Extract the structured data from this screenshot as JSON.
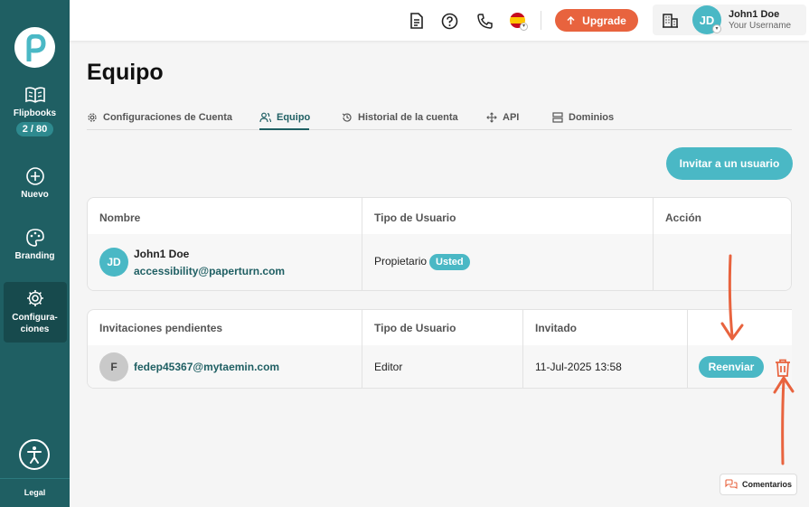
{
  "sidebar": {
    "items": [
      {
        "label": "Flipbooks",
        "icon": "book-icon",
        "badge": "2 / 80"
      },
      {
        "label": "Nuevo",
        "icon": "plus-circle-icon"
      },
      {
        "label": "Branding",
        "icon": "palette-icon"
      },
      {
        "label": "Configura-\nciones",
        "icon": "gear-icon",
        "active": true
      }
    ],
    "legal": "Legal"
  },
  "header": {
    "upgrade_label": "Upgrade",
    "user_initials": "JD",
    "user_name": "John1 Doe",
    "user_username": "Your Username"
  },
  "page": {
    "title": "Equipo",
    "tabs": [
      {
        "label": "Configuraciones de Cuenta",
        "icon": "gear-icon"
      },
      {
        "label": "Equipo",
        "icon": "users-icon",
        "active": true
      },
      {
        "label": "Historial de la cuenta",
        "icon": "history-icon"
      },
      {
        "label": "API",
        "icon": "move-icon"
      },
      {
        "label": "Dominios",
        "icon": "server-icon"
      }
    ],
    "invite_button": "Invitar a un usuario"
  },
  "members_table": {
    "headers": [
      "Nombre",
      "Tipo de Usuario",
      "Acción"
    ],
    "rows": [
      {
        "initials": "JD",
        "name": "John1 Doe",
        "email": "accessibility@paperturn.com",
        "type": "Propietario",
        "badge": "Usted"
      }
    ]
  },
  "invites_table": {
    "headers": [
      "Invitaciones pendientes",
      "Tipo de Usuario",
      "Invitado"
    ],
    "rows": [
      {
        "initials": "F",
        "email": "fedep45367@mytaemin.com",
        "type": "Editor",
        "invited": "11-Jul-2025 13:58",
        "action": "Reenviar"
      }
    ]
  },
  "comments_label": "Comentarios",
  "colors": {
    "sidebar": "#1f5f63",
    "accent": "#4ab8c5",
    "upgrade": "#e8633e",
    "annotation": "#e8633e"
  }
}
